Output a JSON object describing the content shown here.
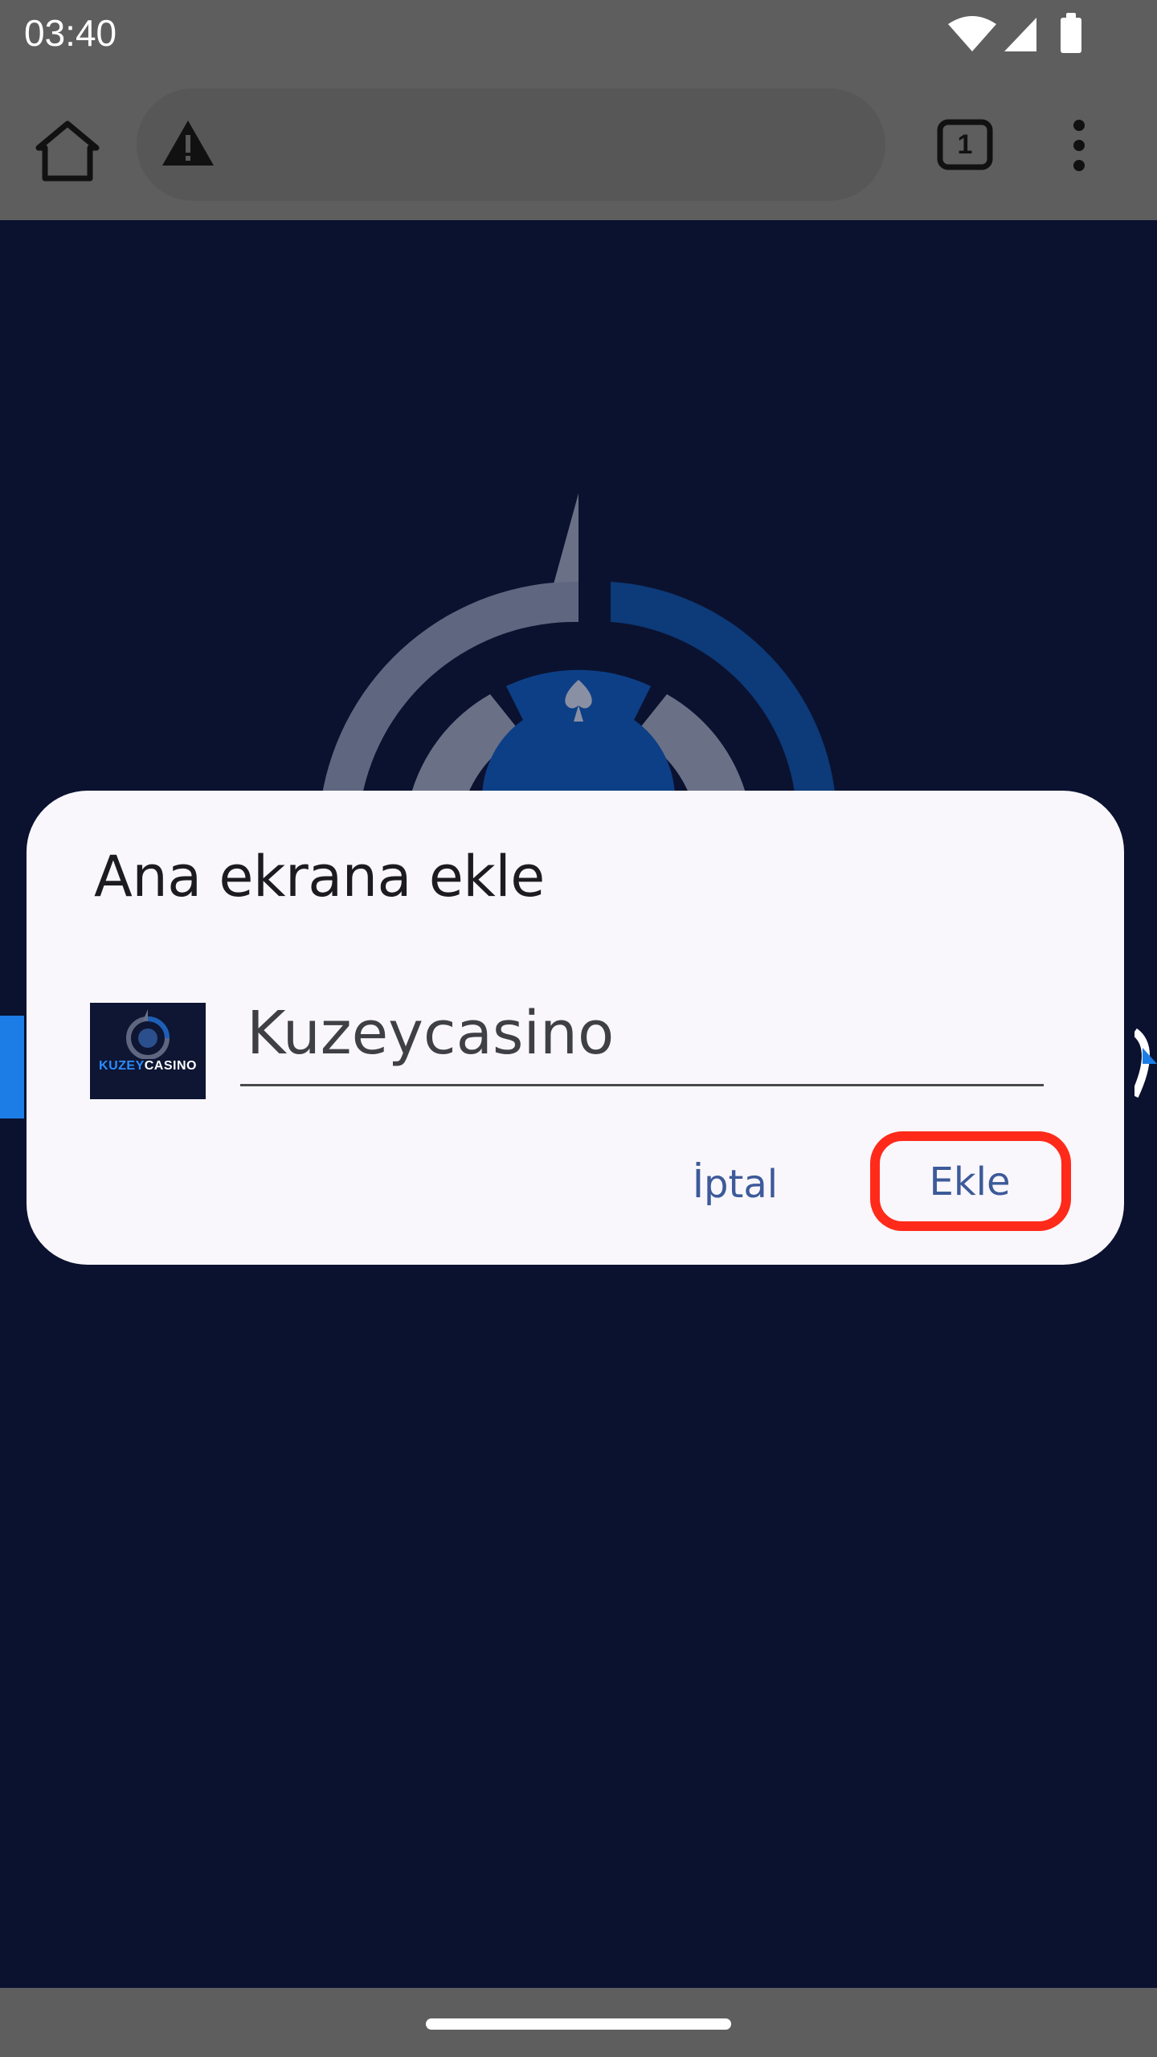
{
  "status_bar": {
    "time": "03:40",
    "icons": [
      "wifi-icon",
      "signal-icon",
      "battery-icon"
    ]
  },
  "toolbar": {
    "tab_count": "1",
    "icons": [
      "home-icon",
      "warning-icon",
      "tabs-icon",
      "more-vert-icon"
    ]
  },
  "page": {
    "background": "#0b1230",
    "logo_text": "KUZEYCASINO"
  },
  "dialog": {
    "title": "Ana ekrana ekle",
    "name_value": "Kuzeycasino",
    "icon_text_part1": "KUZEY",
    "icon_text_part2": "CASINO",
    "cancel_label": "İptal",
    "add_label": "Ekle"
  },
  "colors": {
    "dialog_bg": "#f9f7fc",
    "button_text": "#3d5a99",
    "highlight": "#ff2a1a",
    "system_bars": "#5e5e5e"
  }
}
